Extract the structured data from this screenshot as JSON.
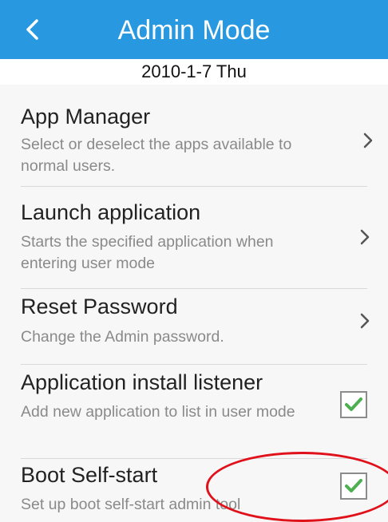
{
  "header": {
    "title": "Admin Mode",
    "back_icon": "chevron-left-icon"
  },
  "date": "2010-1-7 Thu",
  "items": [
    {
      "title": "App Manager",
      "desc": "Select or deselect the apps available to normal users.",
      "control": "chevron-right-icon"
    },
    {
      "title": "Launch application",
      "desc": "Starts the specified application when entering user mode",
      "control": "chevron-right-icon"
    },
    {
      "title": "Reset Password",
      "desc": "Change the Admin password.",
      "control": "chevron-right-icon"
    },
    {
      "title": "Application install listener",
      "desc": "Add new application to list in user mode",
      "control": "checkbox",
      "checked": true
    },
    {
      "title": "Boot Self-start",
      "desc": "Set up boot self-start admin tool",
      "control": "checkbox",
      "checked": true
    }
  ],
  "colors": {
    "header": "#2899e0",
    "check": "#4caf50",
    "annotation": "#e0111a"
  }
}
